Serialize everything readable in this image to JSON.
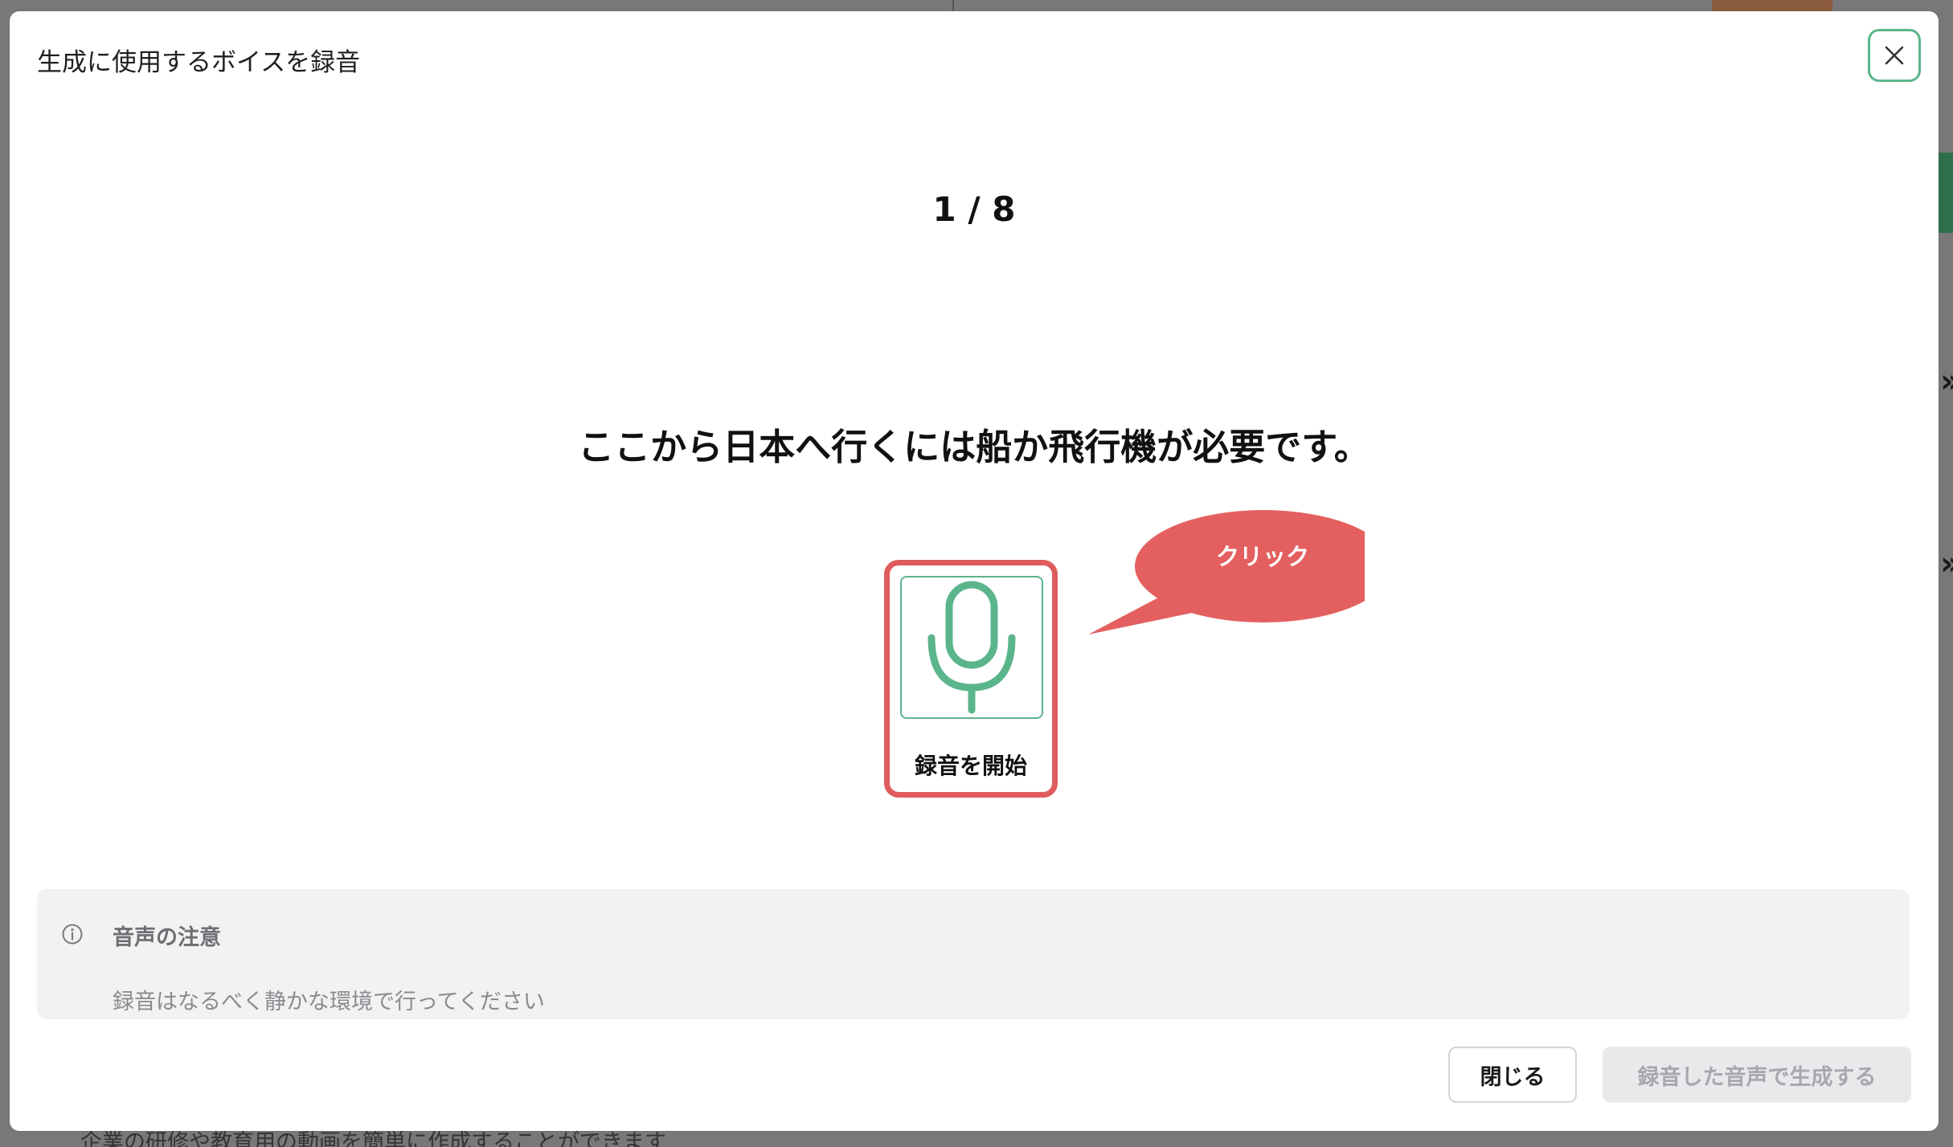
{
  "background_page": {
    "bottom_text": "企業の研修や教育用の動画を簡単に作成することができます"
  },
  "modal": {
    "title": "生成に使用するボイスを録音",
    "close_icon": "close-icon",
    "counter": "1 / 8",
    "sentence": "ここから日本へ行くには船か飛行機が必要です。",
    "record_button": {
      "label": "録音を開始",
      "icon": "microphone-icon",
      "highlight_color": "#e05c5c",
      "accent_color": "#5bb58c"
    },
    "callout": {
      "text": "クリック",
      "color": "#e45f5f"
    },
    "notice": {
      "icon": "info-icon",
      "title": "音声の注意",
      "body": "録音はなるべく静かな環境で行ってください"
    },
    "footer": {
      "close_label": "閉じる",
      "generate_label": "録音した音声で生成する"
    }
  }
}
